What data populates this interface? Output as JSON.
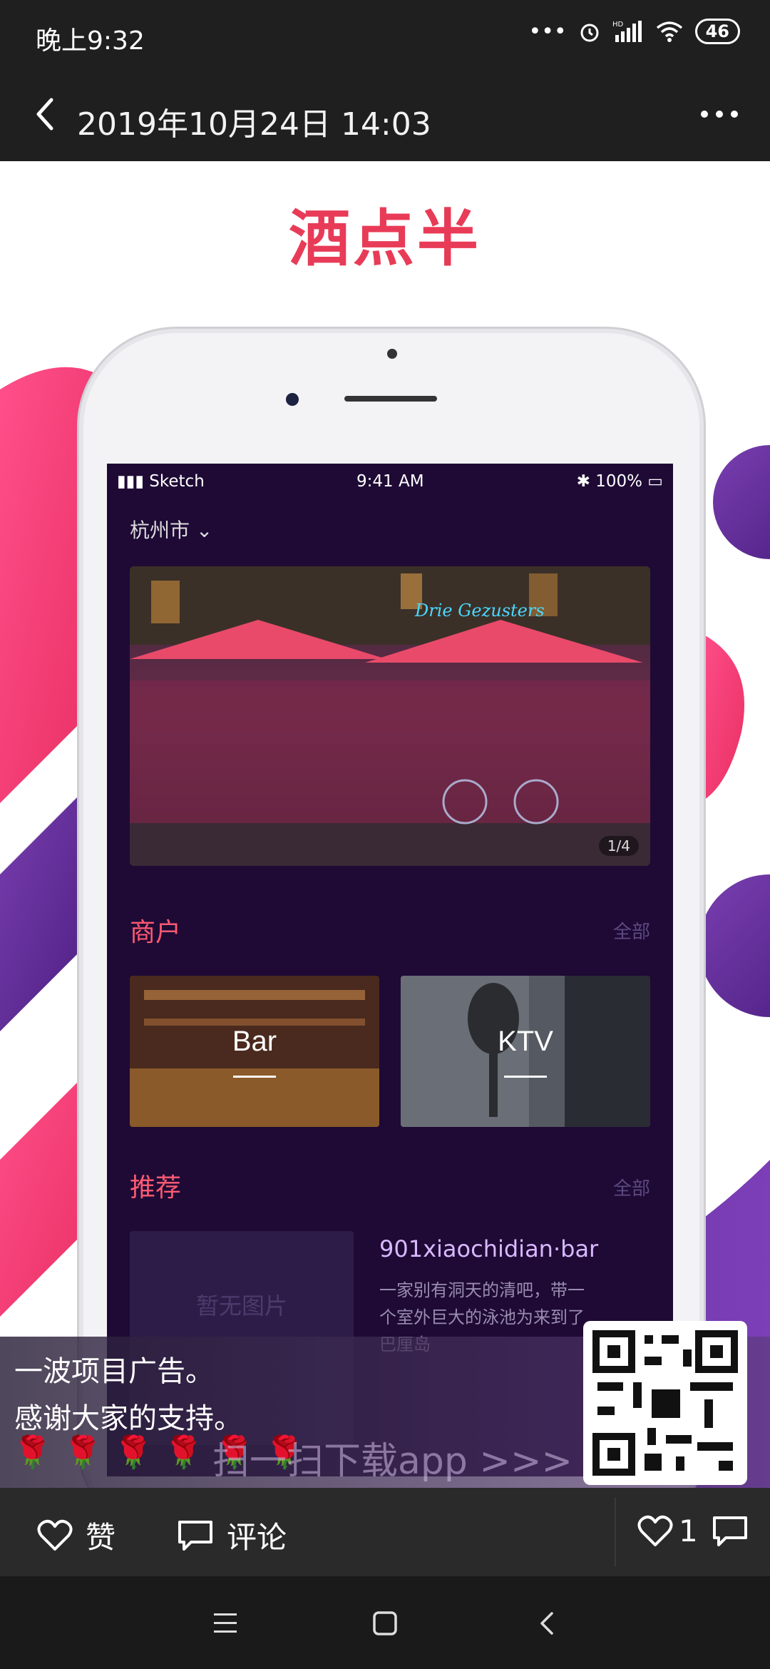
{
  "status_bar": {
    "time": "晚上9:32",
    "signal": "HD",
    "battery": "46"
  },
  "header": {
    "title": "2019年10月24日 14:03"
  },
  "poster": {
    "brand": "酒点半",
    "inner_status": {
      "carrier": "Sketch",
      "time": "9:41 AM",
      "battery": "100%"
    },
    "city": "杭州市",
    "banner_index": "1/4",
    "section_merchants": {
      "title": "商户",
      "all": "全部"
    },
    "cards": [
      {
        "label": "Bar"
      },
      {
        "label": "KTV"
      }
    ],
    "section_recommend": {
      "title": "推荐",
      "all": "全部"
    },
    "no_image": "暂无图片",
    "rec_name": "901xiaochidian·bar",
    "rec_desc": "一家别有洞天的清吧，带一个室外巨大的泳池为来到了巴厘岛"
  },
  "caption": {
    "line1": "一波项目广告。",
    "line2": "感谢大家的支持。",
    "roses": "🌹🌹🌹🌹🌹🌹",
    "scan_text": "扫一扫下载app  >>>"
  },
  "actions": {
    "like": "赞",
    "comment": "评论",
    "like_count": "1"
  },
  "colors": {
    "brand": "#e83b57",
    "accent": "#ff5a72",
    "screen_bg": "#1e0a35"
  }
}
